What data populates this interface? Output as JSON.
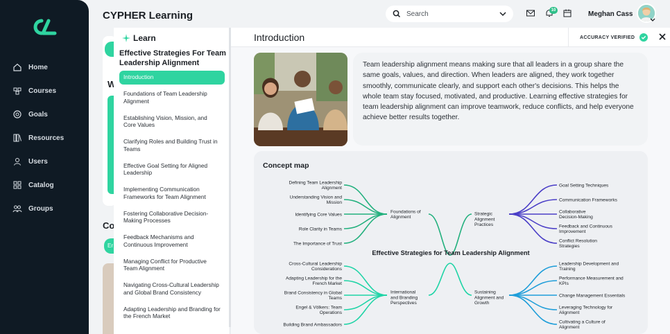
{
  "app": {
    "title": "CYPHER Learning"
  },
  "sidebar": {
    "items": [
      {
        "label": "Home",
        "icon": "home-icon"
      },
      {
        "label": "Courses",
        "icon": "courses-icon"
      },
      {
        "label": "Goals",
        "icon": "goals-icon"
      },
      {
        "label": "Resources",
        "icon": "resources-icon"
      },
      {
        "label": "Users",
        "icon": "users-icon"
      },
      {
        "label": "Catalog",
        "icon": "catalog-icon"
      },
      {
        "label": "Groups",
        "icon": "groups-icon"
      }
    ]
  },
  "header": {
    "search_placeholder": "Search",
    "notification_count": "10",
    "user_name": "Meghan Cass"
  },
  "learn": {
    "heading": "Learn",
    "course_title": "Effective Strategies For Team Leadership Alignment",
    "items": [
      "Introduction",
      "Foundations of Team Leadership Alignment",
      "Establishing Vision, Mission, and Core Values",
      "Clarifying Roles and Building Trust in Teams",
      "Effective Goal Setting for Aligned Leadership",
      "Implementing Communication Frameworks for Team Alignment",
      "Fostering Collaborative Decision-Making Processes",
      "Feedback Mechanisms and Continuous Improvement",
      "Managing Conflict for Productive Team Alignment",
      "Navigating Cross-Cultural Leadership and Global Brand Consistency",
      "Adapting Leadership and Branding for the French Market"
    ]
  },
  "main": {
    "title": "Introduction",
    "accuracy_label": "ACCURACY VERIFIED",
    "intro_text": "Team leadership alignment means making sure that all leaders in a group share the same goals, values, and direction. When leaders are aligned, they work together smoothly, communicate clearly, and support each other's decisions. This helps the whole team stay focused, motivated, and productive. Learning effective strategies for team leadership alignment can improve teamwork, reduce conflicts, and help everyone achieve better results together.",
    "concept_map": {
      "title": "Concept map",
      "center": "Effective Strategies for Team Leadership Alignment",
      "branches": [
        {
          "label": "Foundations of Alignment",
          "color": "#22b07d",
          "leaves": [
            "Defining Team Leadership Alignment",
            "Understanding Vision and Mission",
            "Identifying Core Values",
            "Role Clarity in Teams",
            "The Importance of Trust"
          ]
        },
        {
          "label": "Strategic Alignment Practices",
          "color": "#4b3fc7",
          "leaves": [
            "Goal Setting Techniques",
            "Communication Frameworks",
            "Collaborative Decision-Making",
            "Feedback and Continuous Improvement",
            "Conflict Resolution Strategies"
          ]
        },
        {
          "label": "International and Branding Perspectives",
          "color": "#1fd4a6",
          "leaves": [
            "Cross-Cultural Leadership Considerations",
            "Adapting Leadership for the French Market",
            "Brand Consistency in Global Teams",
            "Engel & Völkers: Team Operations",
            "Building Brand Ambassadors"
          ]
        },
        {
          "label": "Sustaining Alignment and Growth",
          "color": "#1f9ed9",
          "leaves": [
            "Leadership Development and Training",
            "Performance Measurement and KPIs",
            "Change Management Essentials",
            "Leveraging Technology for Alignment",
            "Cultivating a Culture of Alignment"
          ]
        }
      ]
    }
  },
  "colors": {
    "sidebar": "#0f1a24",
    "accent": "#2fd4a0"
  }
}
